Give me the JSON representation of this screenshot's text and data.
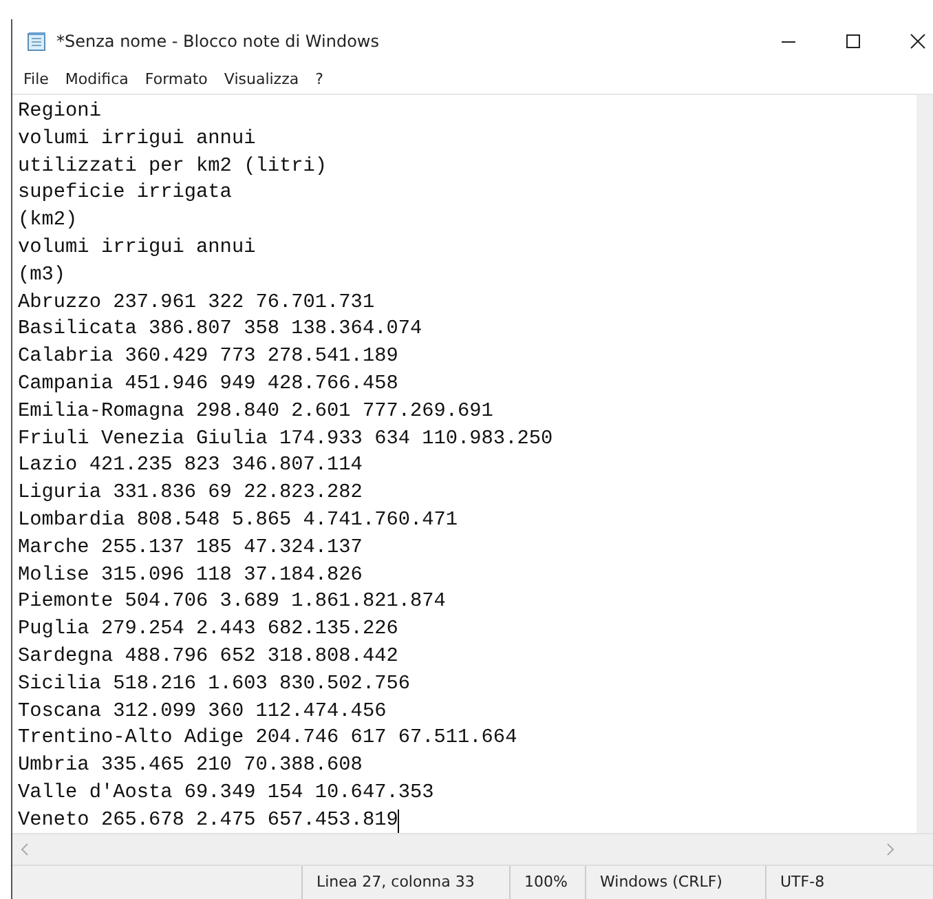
{
  "window": {
    "title": "*Senza nome - Blocco note di Windows"
  },
  "menu": [
    "File",
    "Modifica",
    "Formato",
    "Visualizza",
    "?"
  ],
  "editor": {
    "lines": [
      "Regioni",
      "volumi irrigui annui",
      "utilizzati per km2 (litri)",
      "supeficie irrigata",
      "(km2)",
      "volumi irrigui annui",
      "(m3)",
      "Abruzzo 237.961 322 76.701.731",
      "Basilicata 386.807 358 138.364.074",
      "Calabria 360.429 773 278.541.189",
      "Campania 451.946 949 428.766.458",
      "Emilia-Romagna 298.840 2.601 777.269.691",
      "Friuli Venezia Giulia 174.933 634 110.983.250",
      "Lazio 421.235 823 346.807.114",
      "Liguria 331.836 69 22.823.282",
      "Lombardia 808.548 5.865 4.741.760.471",
      "Marche 255.137 185 47.324.137",
      "Molise 315.096 118 37.184.826",
      "Piemonte 504.706 3.689 1.861.821.874",
      "Puglia 279.254 2.443 682.135.226",
      "Sardegna 488.796 652 318.808.442",
      "Sicilia 518.216 1.603 830.502.756",
      "Toscana 312.099 360 112.474.456",
      "Trentino-Alto Adige 204.746 617 67.511.664",
      "Umbria 335.465 210 70.388.608",
      "Valle d'Aosta 69.349 154 10.647.353",
      "Veneto 265.678 2.475 657.453.819"
    ]
  },
  "status_bar": [
    "Linea 27, colonna 33",
    "100%",
    "Windows (CRLF)",
    "UTF-8"
  ]
}
